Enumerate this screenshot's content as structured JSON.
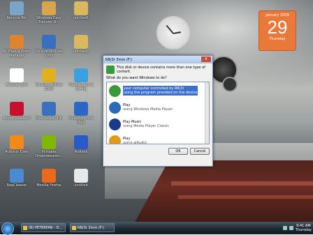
{
  "desktop": {
    "icons": [
      {
        "label": "Recycle Bin",
        "icon": "recycle-bin-icon",
        "color": "#7aa5c8"
      },
      {
        "label": "Windows Easy Transfer R...",
        "icon": "house-icon",
        "color": "#d9a44a"
      },
      {
        "label": "untitled1",
        "icon": "folder-icon",
        "color": "#d9b860"
      },
      {
        "label": "ACDSee 9 Photo Manager",
        "icon": "camera-icon",
        "color": "#e0832e"
      },
      {
        "label": "TuneUp Utilities 2009",
        "icon": "tuneup-icon",
        "color": "#3a6ec0"
      },
      {
        "label": "untitled2",
        "icon": "folder-icon",
        "color": "#d9b860"
      },
      {
        "label": "Acrobat.com",
        "icon": "acrobat-icon",
        "color": "#ffffff"
      },
      {
        "label": "TuneUp Utilities 2009",
        "icon": "tuneup-key-icon",
        "color": "#e0b020"
      },
      {
        "label": "VistaDrpsmt 2 Config",
        "icon": "vista-icon",
        "color": "#3aa0e0"
      },
      {
        "label": "Adobe Reader 9",
        "icon": "adobe-reader-icon",
        "color": "#c8102e"
      },
      {
        "label": "Free Pascal IDE",
        "icon": "pascal-icon",
        "color": "#3a70c0"
      },
      {
        "label": "VistaDrpsmt 2 Help",
        "icon": "help-icon",
        "color": "#2a68c8"
      },
      {
        "label": "Autorun Exec",
        "icon": "vlc-icon",
        "color": "#f08a1a"
      },
      {
        "label": "Portable Dreamweaver...",
        "icon": "dreamweaver-icon",
        "color": "#7fb800"
      },
      {
        "label": "AuRack",
        "icon": "aurack-icon",
        "color": "#2a5ac8"
      },
      {
        "label": "RegCleaner",
        "icon": "regcleaner-icon",
        "color": "#4a8ad0"
      },
      {
        "label": "Mozilla Firefox",
        "icon": "firefox-icon",
        "color": "#e86a1a"
      },
      {
        "label": "untitled",
        "icon": "document-icon",
        "color": "#e8e8e8"
      }
    ]
  },
  "calendar": {
    "month": "January 2009",
    "day": "29",
    "weekday": "Thursday"
  },
  "dialog": {
    "title": "RB/3r 3mm (F:)",
    "close_label": "x",
    "message": "This disk or device contains more than one type of content.",
    "question": "What do you want Windows to do?",
    "options": [
      {
        "title": "your computer controlled by RB/3r",
        "subtitle": "using the program provided on the device",
        "icon": "autorun-icon",
        "color": "#3a9a3a"
      },
      {
        "title": "Play",
        "subtitle": "using Windows Media Player",
        "icon": "media-player-icon",
        "color": "#2a6ab8"
      },
      {
        "title": "Play Music",
        "subtitle": "using Media Player Classic",
        "icon": "mpc-icon",
        "color": "#1a3a8a"
      },
      {
        "title": "Play",
        "subtitle": "using aiAudio",
        "icon": "aiaudio-icon",
        "color": "#e09a1a"
      }
    ],
    "ok_label": "OK",
    "cancel_label": "Cancel"
  },
  "taskbar": {
    "buttons": [
      {
        "label": "(B) PETERFAN - O..."
      },
      {
        "label": "RB/3r 3mm (F:)"
      }
    ],
    "time": "9:41 AM",
    "date": "Thursday"
  }
}
